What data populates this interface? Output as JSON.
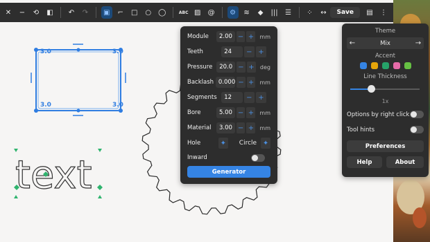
{
  "toolbar": {
    "save_label": "Save",
    "icons": [
      "close-icon",
      "minimize-icon",
      "reset-icon",
      "sidebar-icon",
      "undo-icon",
      "redo-icon",
      "select-tool-icon",
      "path-tool-icon",
      "rectangle-tool-icon",
      "ellipse-tool-icon",
      "circle-tool-icon",
      "text-tool-icon",
      "image-tool-icon",
      "spiral-tool-icon",
      "gear-tool-icon",
      "signal-tool-icon",
      "shield-tool-icon",
      "barcode-tool-icon",
      "list-tool-icon",
      "grid-icon",
      "arrows-icon",
      "export-icon",
      "menu-icon"
    ]
  },
  "canvas": {
    "rect_dims": {
      "tl": "3.0",
      "tr": "3.0",
      "bl": "3.0",
      "br": "3.0"
    },
    "text_object": "text"
  },
  "gear_panel": {
    "rows": [
      {
        "label": "Module",
        "value": "2.00",
        "unit": "mm"
      },
      {
        "label": "Teeth",
        "value": "24",
        "unit": ""
      },
      {
        "label": "Pressure",
        "value": "20.0",
        "unit": "deg"
      },
      {
        "label": "Backlash",
        "value": "0.000",
        "unit": "mm"
      },
      {
        "label": "Segments",
        "value": "12",
        "unit": ""
      },
      {
        "label": "Bore",
        "value": "5.00",
        "unit": "mm"
      },
      {
        "label": "Material",
        "value": "3.00",
        "unit": "mm"
      }
    ],
    "hole_label": "Hole",
    "circle_label": "Circle",
    "inward_label": "Inward",
    "generator_label": "Generator"
  },
  "settings_menu": {
    "theme_label": "Theme",
    "theme_value": "Mix",
    "accent_label": "Accent",
    "accent_colors": [
      "#3584e4",
      "#e5a50a",
      "#26a269",
      "#e66ba8",
      "#66c043"
    ],
    "line_thickness_label": "Line Thickness",
    "line_thickness_value": "1x",
    "line_thickness_level": 0.3,
    "options_right_click": "Options by right click",
    "tool_hints": "Tool hints",
    "preferences_label": "Preferences",
    "help_label": "Help",
    "about_label": "About"
  },
  "colors": {
    "accent": "#3584e4",
    "panel": "#2d2d2d",
    "selection": "#2f7de1",
    "handle": "#2fb46e"
  }
}
